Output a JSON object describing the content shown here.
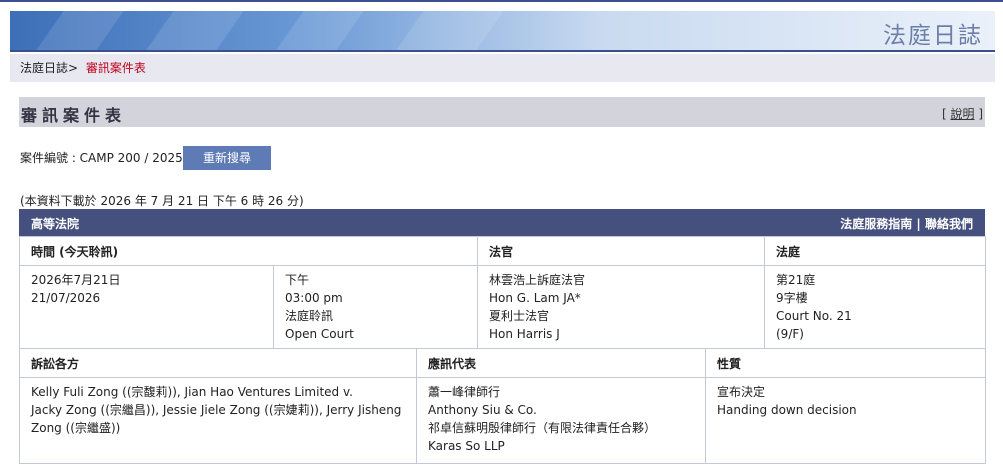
{
  "banner": {
    "title": "法庭日誌"
  },
  "breadcrumb": {
    "home": "法庭日誌",
    "separator": ">",
    "current": "審訊案件表"
  },
  "page": {
    "title": "審訊案件表",
    "help": "說明"
  },
  "case": {
    "label": "案件編號 : CAMP 200 / 2025",
    "search_button": "重新搜尋"
  },
  "download_note": "(本資料下載於 2026 年 7 月 21 日 下午 6 時 26 分)",
  "court": {
    "name": "高等法院",
    "guide_link": "法庭服務指南",
    "contact_link": "聯絡我們"
  },
  "hearing_table": {
    "headers": {
      "time": "時間 (今天聆訊)",
      "judge": "法官",
      "court": "法庭"
    },
    "date_lines": [
      "2026年7月21日",
      "21/07/2026"
    ],
    "time_lines": [
      "下午",
      "03:00 pm",
      "法庭聆訊",
      "Open Court"
    ],
    "judge_lines": [
      "林雲浩上訴庭法官",
      "Hon G. Lam JA*",
      "夏利士法官",
      "Hon Harris J"
    ],
    "court_lines": [
      "第21庭",
      "9字樓",
      "Court No. 21",
      "(9/F)"
    ]
  },
  "parties_table": {
    "headers": {
      "parties": "訴訟各方",
      "representation": "應訊代表",
      "nature": "性質"
    },
    "parties_lines": [
      "Kelly Fuli Zong ((宗馥莉)), Jian Hao Ventures Limited v.",
      "Jacky Zong ((宗繼昌)), Jessie Jiele Zong ((宗婕莉)), Jerry Jisheng",
      "Zong ((宗繼盛))"
    ],
    "representation_lines": [
      "蕭一峰律師行",
      "Anthony Siu & Co.",
      "祁卓信蘇明殷律師行（有限法律責任合夥）",
      "Karas So LLP"
    ],
    "nature_lines": [
      "宣布決定",
      "Handing down decision"
    ]
  }
}
